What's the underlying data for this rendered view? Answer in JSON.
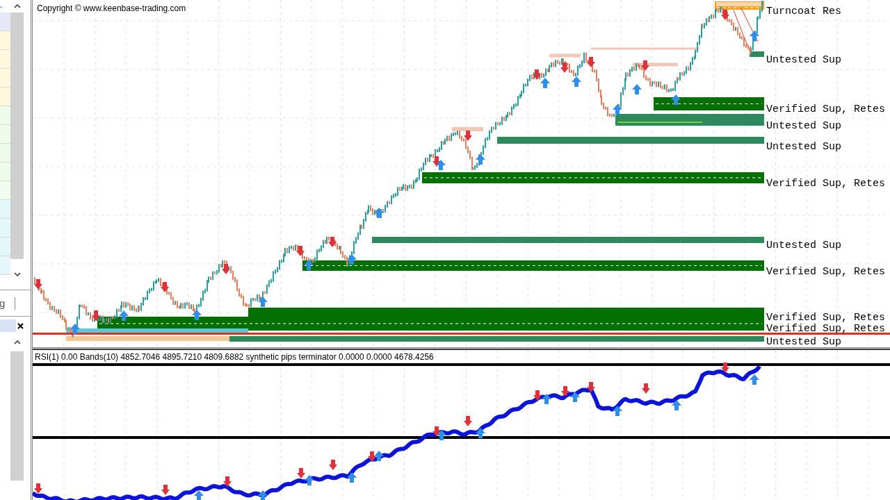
{
  "sidebar": {
    "list_text": ".",
    "tab_label": "g"
  },
  "chart": {
    "copyright": "Copyright © www.keenbase-trading.com",
    "zones": [
      {
        "kind": "turncoat",
        "label": "Turncoat Res"
      },
      {
        "kind": "untested",
        "label": "Untested Sup"
      },
      {
        "kind": "verified",
        "label": "Verified Sup, Retes"
      },
      {
        "kind": "untested",
        "label": "Untested Sup"
      },
      {
        "kind": "untested",
        "label": "Untested Sup"
      },
      {
        "kind": "verified",
        "label": "Verified Sup, Retes"
      },
      {
        "kind": "untested",
        "label": "Untested Sup"
      },
      {
        "kind": "verified",
        "label": "Verified Sup, Retes"
      },
      {
        "kind": "verified",
        "label": "Verified Sup, Retes"
      },
      {
        "kind": "verified",
        "label": "Verified Sup, Retes"
      },
      {
        "kind": "untested",
        "label": "Untested Sup"
      }
    ]
  },
  "indicator": {
    "legend": "RSI(1) 0.00 Bands(10) 4852.7046 4895.7210 4809.6882 synthetic pips terminator 0.0000 0.0000 4678.4256"
  }
}
